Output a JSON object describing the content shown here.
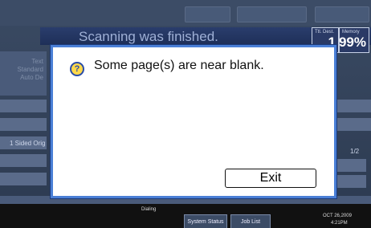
{
  "header": {
    "scan_message": "Scanning was finished.",
    "fill_dest_label": "Ttl. Dest.",
    "fill_dest_value": "1",
    "memory_label": "Memory",
    "memory_value": "99%"
  },
  "background": {
    "left_labels": [
      "Text",
      "Standard",
      "Auto De"
    ],
    "one_sided": "1 Sided Orig",
    "page_indicator": "1/2"
  },
  "dialog": {
    "message": "Some page(s) are near blank.",
    "exit_label": "Exit"
  },
  "bottom": {
    "dialing": "Dialing",
    "system_status": "System Status",
    "job_list": "Job List",
    "date": "OCT 26,2009",
    "time": "4:21PM"
  },
  "colors": {
    "dialog_border": "#4a7fd6",
    "icon_fill": "#ffd84a"
  }
}
